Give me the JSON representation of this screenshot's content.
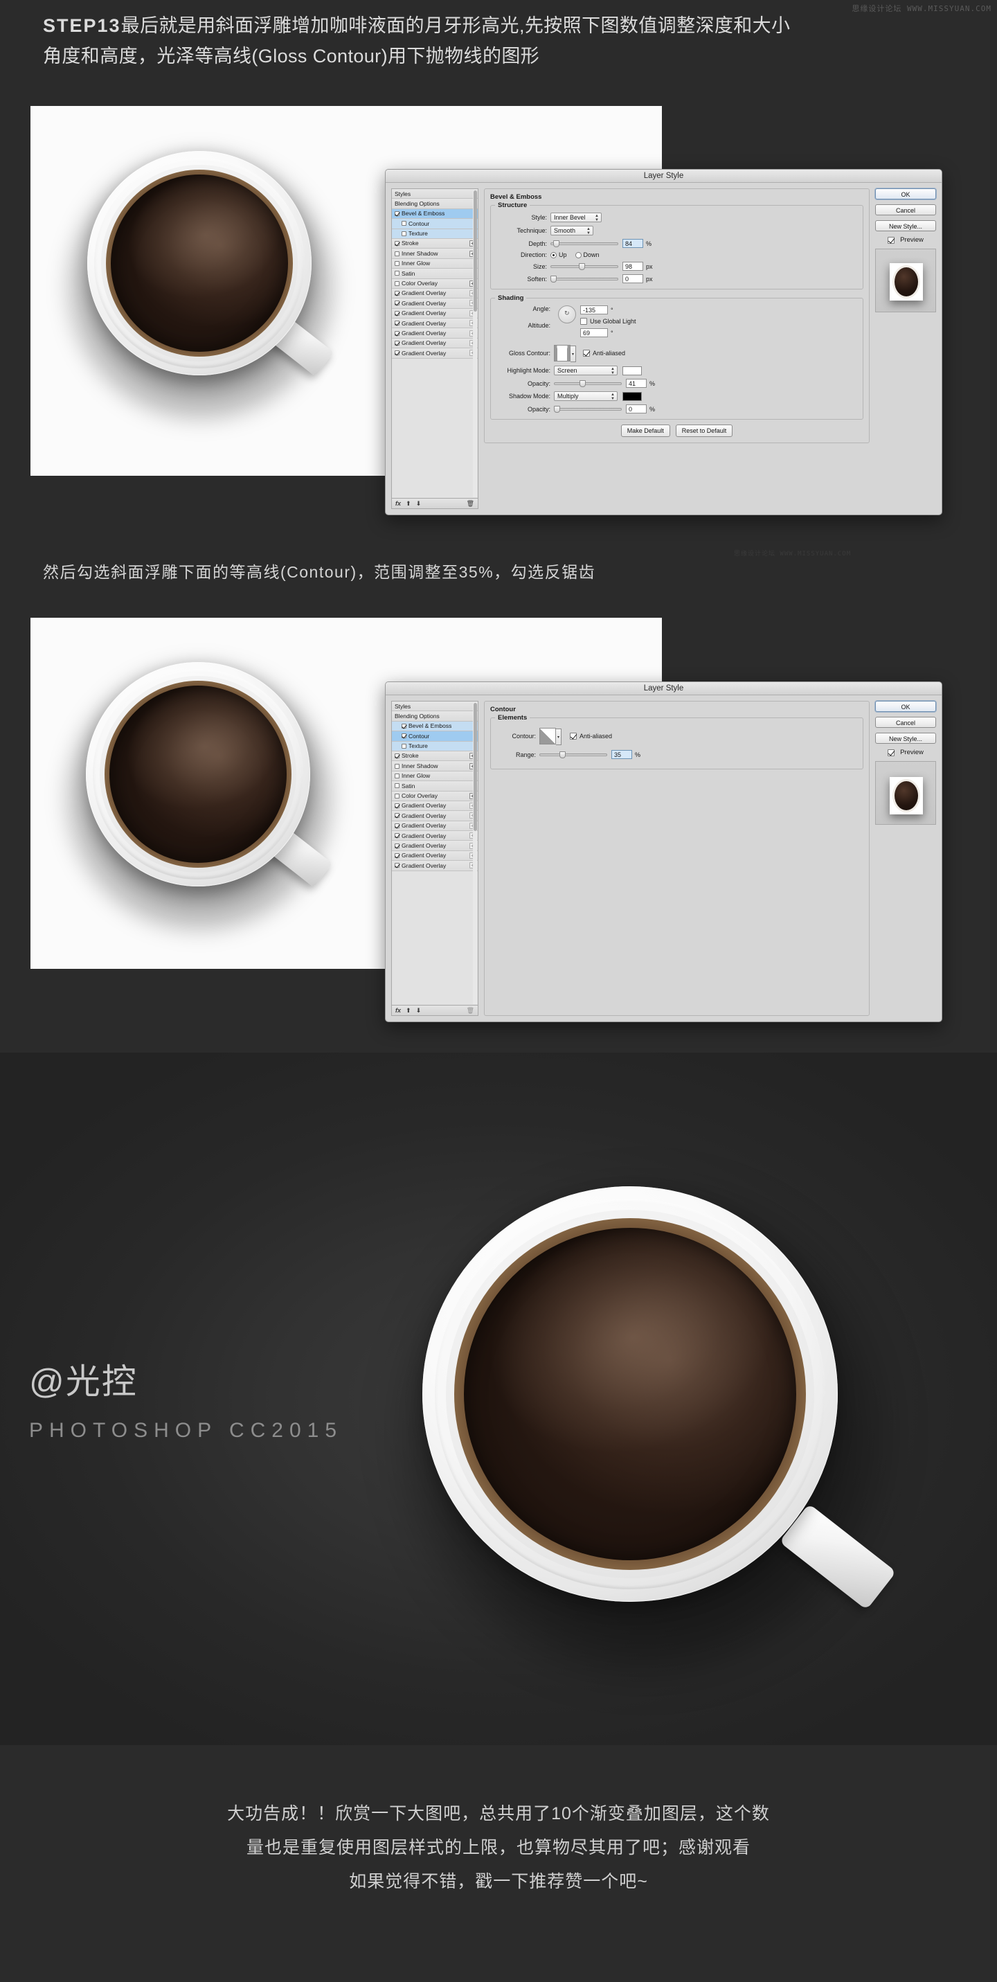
{
  "page": {
    "background": "#2b2b2b",
    "watermark_top": "思缘设计论坛  WWW.MISSYUAN.COM",
    "watermark_mid": "思缘设计论坛  WWW.MISSYUAN.COM"
  },
  "intro": {
    "step_label": "STEP13",
    "line1": "最后就是用斜面浮雕增加咖啡液面的月牙形高光,先按照下图数值调整深度和大小",
    "line2": "角度和高度，光泽等高线(Gloss Contour)用下抛物线的图形"
  },
  "caption_mid": "然后勾选斜面浮雕下面的等高线(Contour)，范围调整至35%，勾选反锯齿",
  "dialog1": {
    "title": "Layer Style",
    "styles_header": [
      "Styles",
      "Blending Options"
    ],
    "styles_items": [
      {
        "label": "Styles",
        "type": "plain"
      },
      {
        "label": "Blending Options",
        "type": "plain"
      },
      {
        "label": "Bevel & Emboss",
        "checked": true,
        "selected": true
      },
      {
        "label": "Contour",
        "checked": false,
        "child": true,
        "highlight": true
      },
      {
        "label": "Texture",
        "checked": false,
        "child": true,
        "highlight": true
      },
      {
        "label": "Stroke",
        "checked": true,
        "plus": true
      },
      {
        "label": "Inner Shadow",
        "checked": false,
        "plus": true
      },
      {
        "label": "Inner Glow",
        "checked": false
      },
      {
        "label": "Satin",
        "checked": false
      },
      {
        "label": "Color Overlay",
        "checked": false,
        "plus": true
      },
      {
        "label": "Gradient Overlay",
        "checked": true,
        "plus": true,
        "dim": true
      },
      {
        "label": "Gradient Overlay",
        "checked": true,
        "plus": true,
        "dim": true
      },
      {
        "label": "Gradient Overlay",
        "checked": true,
        "plus": true,
        "dim": true
      },
      {
        "label": "Gradient Overlay",
        "checked": true,
        "plus": true,
        "dim": true
      },
      {
        "label": "Gradient Overlay",
        "checked": true,
        "plus": true,
        "dim": true
      },
      {
        "label": "Gradient Overlay",
        "checked": true,
        "plus": true,
        "dim": true
      },
      {
        "label": "Gradient Overlay",
        "checked": true,
        "plus": true,
        "dim": true
      }
    ],
    "footer_icons": [
      "fx-icon",
      "arrow-up-icon",
      "arrow-down-icon",
      "trash-icon"
    ],
    "panel_title": "Bevel & Emboss",
    "structure": {
      "title": "Structure",
      "style_label": "Style:",
      "style_value": "Inner Bevel",
      "technique_label": "Technique:",
      "technique_value": "Smooth",
      "depth_label": "Depth:",
      "depth_value": "84",
      "depth_unit": "%",
      "depth_pct": 6,
      "direction_label": "Direction:",
      "direction_up": "Up",
      "direction_down": "Down",
      "direction_selected": "Up",
      "size_label": "Size:",
      "size_value": "98",
      "size_unit": "px",
      "size_pct": 44,
      "soften_label": "Soften:",
      "soften_value": "0",
      "soften_unit": "px",
      "soften_pct": 0
    },
    "shading": {
      "title": "Shading",
      "angle_label": "Angle:",
      "angle_value": "-135",
      "angle_unit": "°",
      "use_global_light_label": "Use Global Light",
      "use_global_light": false,
      "altitude_label": "Altitude:",
      "altitude_value": "69",
      "altitude_unit": "°",
      "gloss_contour_label": "Gloss Contour:",
      "anti_aliased_label": "Anti-aliased",
      "anti_aliased": true,
      "highlight_mode_label": "Highlight Mode:",
      "highlight_mode_value": "Screen",
      "highlight_color": "#ffffff",
      "highlight_opacity_label": "Opacity:",
      "highlight_opacity_value": "41",
      "highlight_opacity_unit": "%",
      "highlight_opacity_pct": 41,
      "shadow_mode_label": "Shadow Mode:",
      "shadow_mode_value": "Multiply",
      "shadow_color": "#000000",
      "shadow_opacity_label": "Opacity:",
      "shadow_opacity_value": "0",
      "shadow_opacity_unit": "%",
      "shadow_opacity_pct": 0
    },
    "make_default": "Make Default",
    "reset_to_default": "Reset to Default",
    "ok": "OK",
    "cancel": "Cancel",
    "new_style": "New Style...",
    "preview_label": "Preview",
    "preview_checked": true
  },
  "dialog2": {
    "title": "Layer Style",
    "styles_items": [
      {
        "label": "Styles",
        "type": "plain"
      },
      {
        "label": "Blending Options",
        "type": "plain"
      },
      {
        "label": "Bevel & Emboss",
        "checked": true,
        "highlight": true
      },
      {
        "label": "Contour",
        "checked": true,
        "child": true,
        "selected": true
      },
      {
        "label": "Texture",
        "checked": false,
        "child": true,
        "highlight": true
      },
      {
        "label": "Stroke",
        "checked": true,
        "plus": true
      },
      {
        "label": "Inner Shadow",
        "checked": false,
        "plus": true
      },
      {
        "label": "Inner Glow",
        "checked": false
      },
      {
        "label": "Satin",
        "checked": false
      },
      {
        "label": "Color Overlay",
        "checked": false,
        "plus": true
      },
      {
        "label": "Gradient Overlay",
        "checked": true,
        "plus": true,
        "dim": true
      },
      {
        "label": "Gradient Overlay",
        "checked": true,
        "plus": true,
        "dim": true
      },
      {
        "label": "Gradient Overlay",
        "checked": true,
        "plus": true,
        "dim": true
      },
      {
        "label": "Gradient Overlay",
        "checked": true,
        "plus": true,
        "dim": true
      },
      {
        "label": "Gradient Overlay",
        "checked": true,
        "plus": true,
        "dim": true
      },
      {
        "label": "Gradient Overlay",
        "checked": true,
        "plus": true,
        "dim": true
      },
      {
        "label": "Gradient Overlay",
        "checked": true,
        "plus": true,
        "dim": true
      }
    ],
    "panel_title": "Contour",
    "elements": {
      "title": "Elements",
      "contour_label": "Contour:",
      "anti_aliased_label": "Anti-aliased",
      "anti_aliased": true,
      "range_label": "Range:",
      "range_value": "35",
      "range_unit": "%",
      "range_pct": 32
    },
    "ok": "OK",
    "cancel": "Cancel",
    "new_style": "New Style...",
    "preview_label": "Preview",
    "preview_checked": true
  },
  "signature": {
    "name": "@光控",
    "sub": "PHOTOSHOP CC2015"
  },
  "outro": {
    "line1": "大功告成！！欣赏一下大图吧，总共用了10个渐变叠加图层，这个数",
    "line2": "量也是重复使用图层样式的上限，也算物尽其用了吧；感谢观看",
    "line3": "如果觉得不错，戳一下推荐赞一个吧~"
  }
}
